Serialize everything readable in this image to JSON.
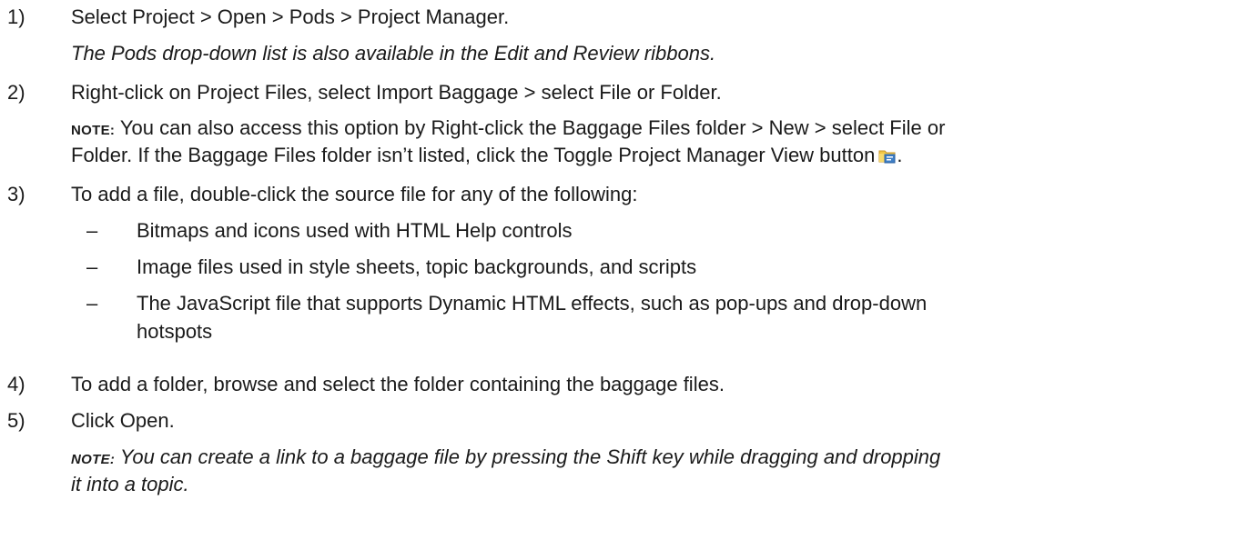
{
  "steps": [
    {
      "number": "1)",
      "text": "Select Project > Open > Pods > Project Manager.",
      "sub": "The Pods drop-down list is also available in the Edit and Review ribbons."
    },
    {
      "number": "2)",
      "text": "Right-click on Project Files, select Import Baggage > select File or Folder.",
      "note_label": "NOTE:",
      "note_line1": " You can also access this option by Right-click the Baggage Files folder > New > select File or",
      "note_line2": "Folder. If the Baggage Files folder isn’t listed, click the Toggle Project Manager View button",
      "note_line2_end": ".",
      "note_icon": "project-manager-view-icon"
    },
    {
      "number": "3)",
      "text": "To add a file, double-click the source file for any of the following:",
      "bullets": [
        "Bitmaps and icons used with HTML Help controls",
        "Image files used in style sheets, topic backgrounds, and scripts",
        "The JavaScript file that supports Dynamic HTML effects, such as pop-ups and drop-down"
      ],
      "bullet_continuation": "hotspots",
      "dash": "–"
    },
    {
      "number": "4)",
      "text": "To add a folder, browse and select the folder containing the baggage files."
    },
    {
      "number": "5)",
      "text": "Click Open.",
      "note_label": "NOTE:",
      "note_line1": " You can create a link to a baggage file by pressing the Shift key while dragging and dropping",
      "note_line2": "it into a topic."
    }
  ]
}
